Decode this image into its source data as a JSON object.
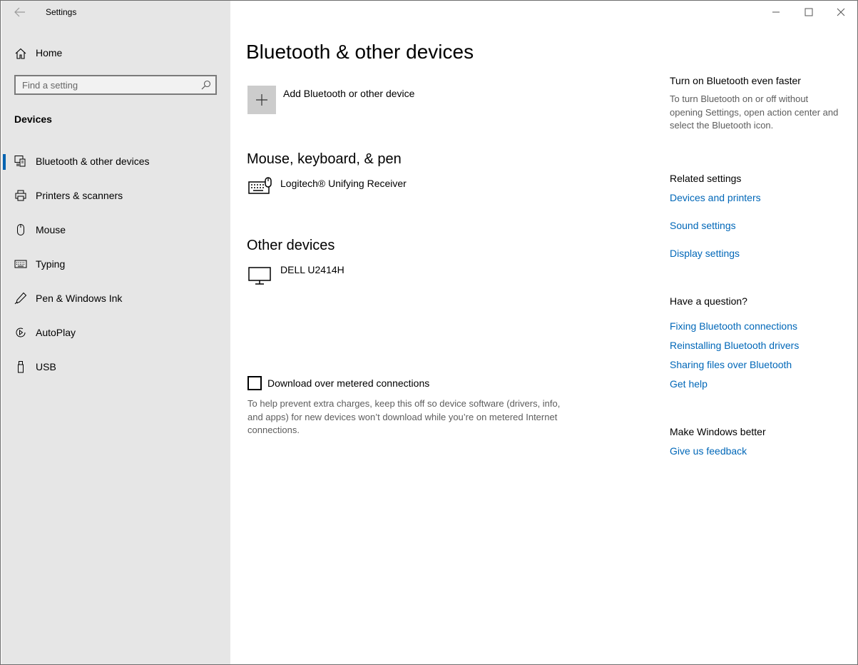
{
  "window": {
    "title": "Settings"
  },
  "sidebar": {
    "home_label": "Home",
    "search_placeholder": "Find a setting",
    "section": "Devices",
    "items": [
      {
        "label": "Bluetooth & other devices",
        "icon": "bluetooth-devices-icon",
        "selected": true
      },
      {
        "label": "Printers & scanners",
        "icon": "printer-icon"
      },
      {
        "label": "Mouse",
        "icon": "mouse-icon"
      },
      {
        "label": "Typing",
        "icon": "keyboard-icon"
      },
      {
        "label": "Pen & Windows Ink",
        "icon": "pen-icon"
      },
      {
        "label": "AutoPlay",
        "icon": "autoplay-icon"
      },
      {
        "label": "USB",
        "icon": "usb-icon"
      }
    ]
  },
  "main": {
    "title": "Bluetooth & other devices",
    "add_device_label": "Add Bluetooth or other device",
    "groups": [
      {
        "title": "Mouse, keyboard, & pen",
        "devices": [
          {
            "name": "Logitech® Unifying Receiver",
            "icon": "keyboard-mouse-icon"
          }
        ]
      },
      {
        "title": "Other devices",
        "devices": [
          {
            "name": "DELL U2414H",
            "icon": "monitor-icon"
          }
        ]
      }
    ],
    "metered": {
      "label": "Download over metered connections",
      "checked": false,
      "help": "To help prevent extra charges, keep this off so device software (drivers, info, and apps) for new devices won’t download while you’re on metered Internet connections."
    }
  },
  "right": {
    "tip_title": "Turn on Bluetooth even faster",
    "tip_text": "To turn Bluetooth on or off without opening Settings, open action center and select the Bluetooth icon.",
    "related_title": "Related settings",
    "related_links": [
      "Devices and printers",
      "Sound settings",
      "Display settings"
    ],
    "question_title": "Have a question?",
    "question_links": [
      "Fixing Bluetooth connections",
      "Reinstalling Bluetooth drivers",
      "Sharing files over Bluetooth",
      "Get help"
    ],
    "better_title": "Make Windows better",
    "feedback_link": "Give us feedback"
  },
  "colors": {
    "accent": "#0063b1",
    "link": "#0067b8",
    "sidebar_bg": "#e6e6e6"
  }
}
